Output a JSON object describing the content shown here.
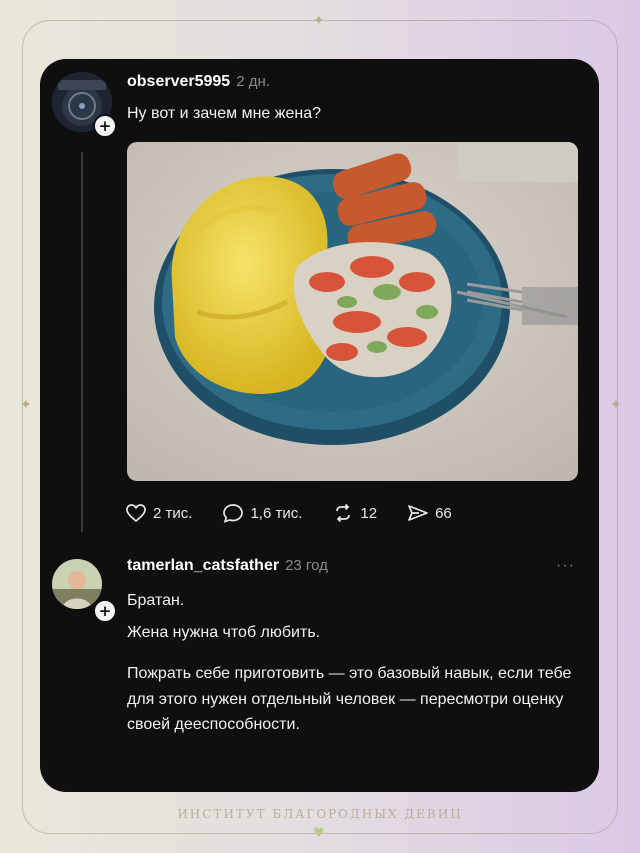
{
  "post": {
    "username": "observer5995",
    "time": "2 дн.",
    "text": "Ну вот и зачем мне жена?",
    "photo_alt": "plate-photo",
    "likes": "2 тис.",
    "comments": "1,6 тис.",
    "reposts": "12",
    "shares": "66"
  },
  "reply": {
    "username": "tamerlan_catsfather",
    "time": "23 год",
    "more": "···",
    "line1": "Братан.",
    "line2": "Жена нужна чтоб любить.",
    "paragraph": "Пожрать себе приготовить — это базовый навык, если тебе для этого нужен отдельный человек — пересмотри оценку своей дееспособности."
  },
  "footer": {
    "brand": "ИНСТИТУТ БЛАГОРОДНЫХ ДЕВИЦ"
  },
  "icons": {
    "like": "heart-outline-icon",
    "comment": "comment-bubble-icon",
    "repost": "repost-arrows-icon",
    "share": "send-arrow-icon"
  }
}
